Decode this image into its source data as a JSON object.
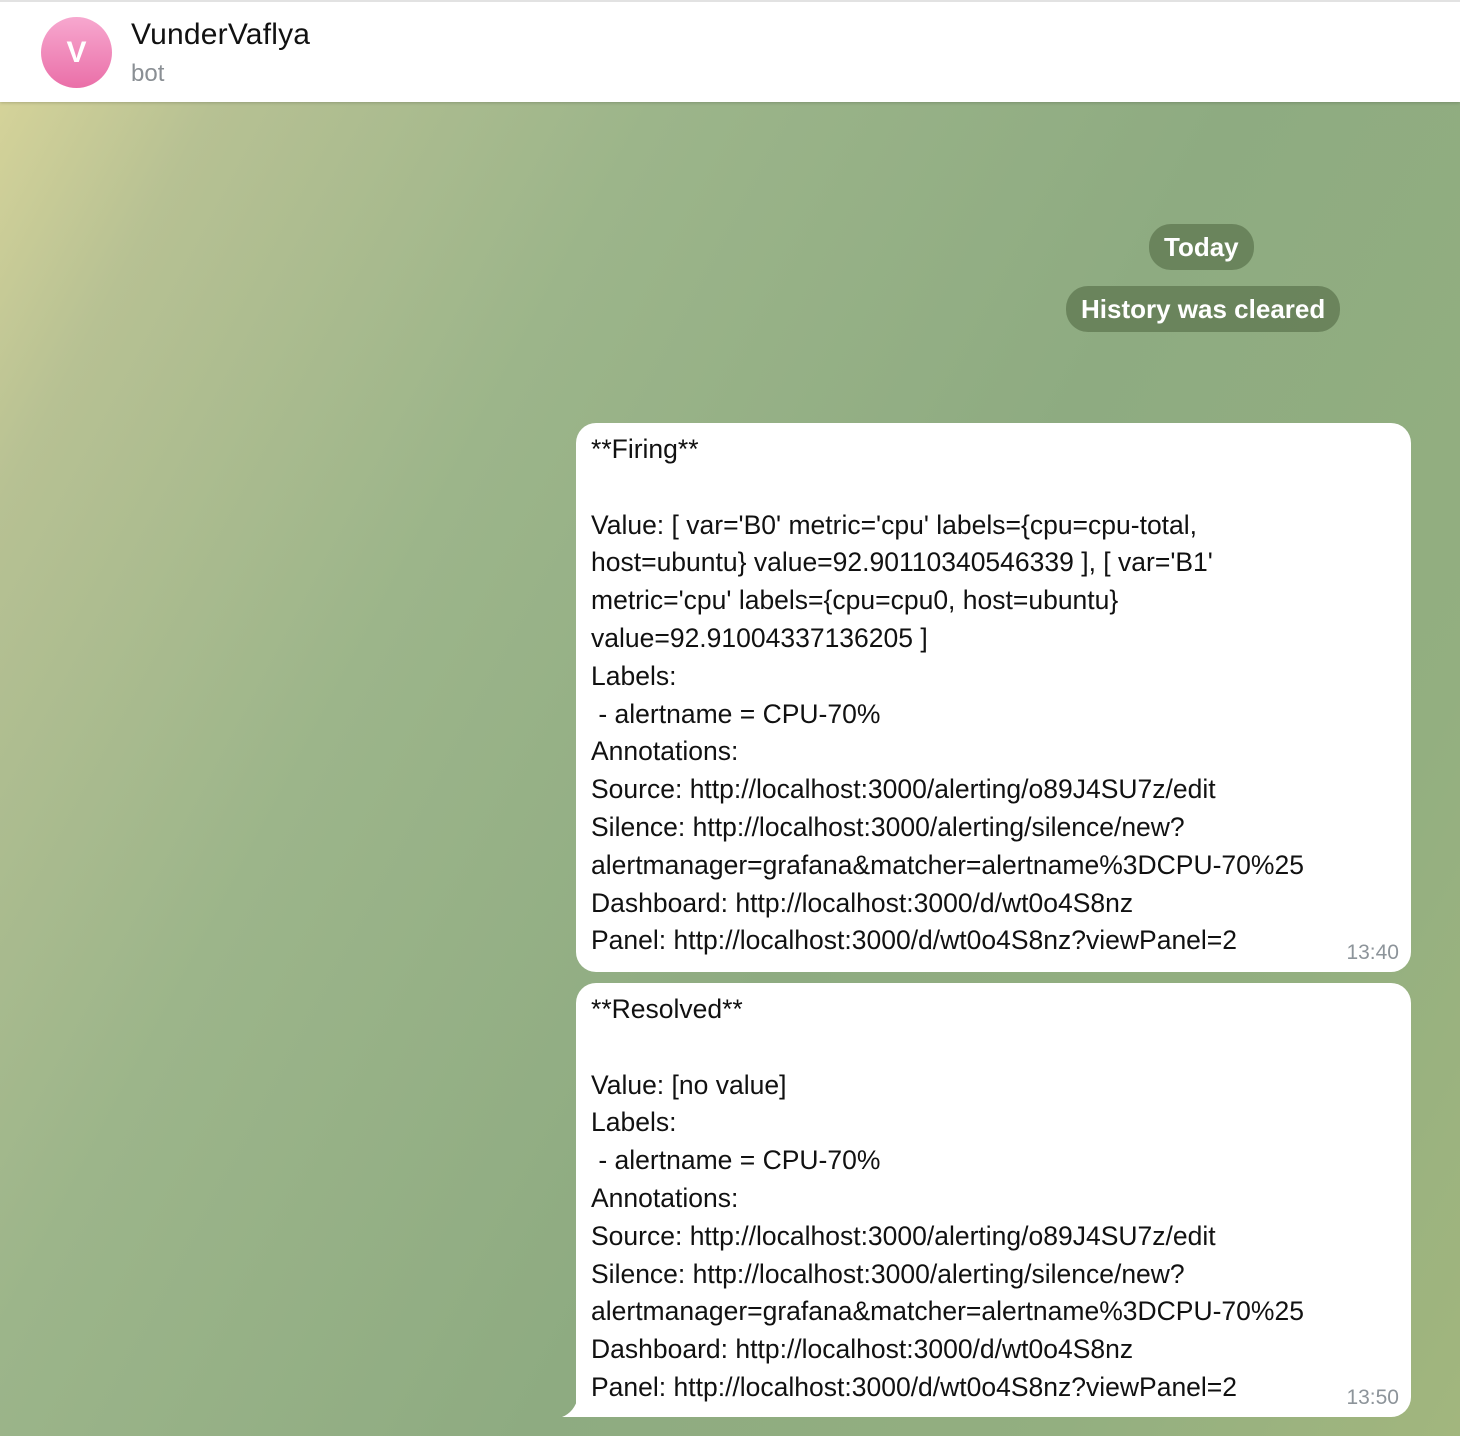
{
  "header": {
    "avatar_letter": "V",
    "chat_name": "VunderVaflya",
    "status": "bot"
  },
  "service": {
    "date": "Today",
    "history": "History was cleared"
  },
  "messages": [
    {
      "lines": [
        "**Firing**",
        "",
        "Value: [ var='B0' metric='cpu' labels={cpu=cpu-total,",
        "host=ubuntu} value=92.90110340546339 ], [ var='B1'",
        "metric='cpu' labels={cpu=cpu0, host=ubuntu}",
        "value=92.91004337136205 ]",
        "Labels:",
        " - alertname = CPU-70%",
        "Annotations:",
        "Source: http://localhost:3000/alerting/o89J4SU7z/edit",
        "Silence: http://localhost:3000/alerting/silence/new?",
        "alertmanager=grafana&matcher=alertname%3DCPU-70%25",
        "Dashboard: http://localhost:3000/d/wt0o4S8nz",
        "Panel: http://localhost:3000/d/wt0o4S8nz?viewPanel=2"
      ],
      "time": "13:40"
    },
    {
      "lines": [
        "**Resolved**",
        "",
        "Value: [no value]",
        "Labels:",
        " - alertname = CPU-70%",
        "Annotations:",
        "Source: http://localhost:3000/alerting/o89J4SU7z/edit",
        "Silence: http://localhost:3000/alerting/silence/new?",
        "alertmanager=grafana&matcher=alertname%3DCPU-70%25",
        "Dashboard: http://localhost:3000/d/wt0o4S8nz",
        "Panel: http://localhost:3000/d/wt0o4S8nz?viewPanel=2"
      ],
      "time": "13:50"
    }
  ]
}
